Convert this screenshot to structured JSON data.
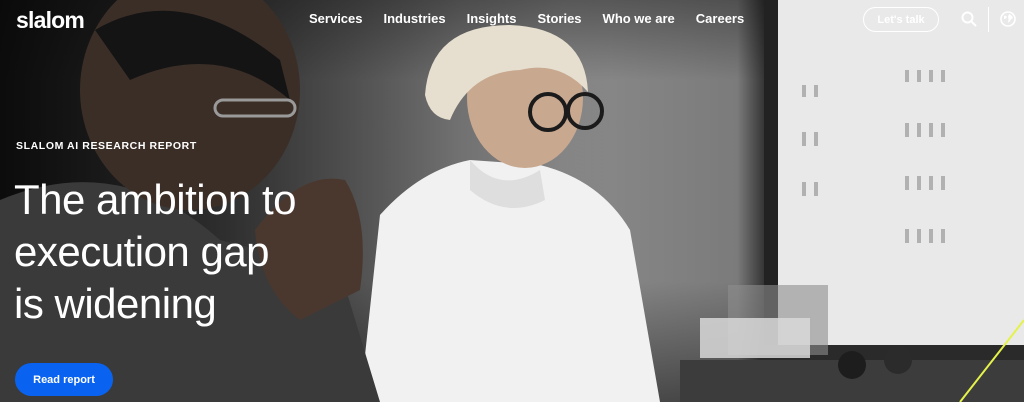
{
  "brand": {
    "logo_text": "slalom"
  },
  "nav": {
    "items": [
      "Services",
      "Industries",
      "Insights",
      "Stories",
      "Who we are",
      "Careers"
    ],
    "cta_label": "Let's talk",
    "icons": [
      "search-icon",
      "globe-icon"
    ]
  },
  "hero": {
    "eyebrow": "SLALOM AI RESEARCH REPORT",
    "headline_lines": [
      "The ambition to",
      "execution gap",
      "is widening"
    ],
    "button_label": "Read report"
  },
  "colors": {
    "accent": "#0a63f0",
    "text": "#ffffff",
    "highlight_line": "#e4f24a"
  }
}
